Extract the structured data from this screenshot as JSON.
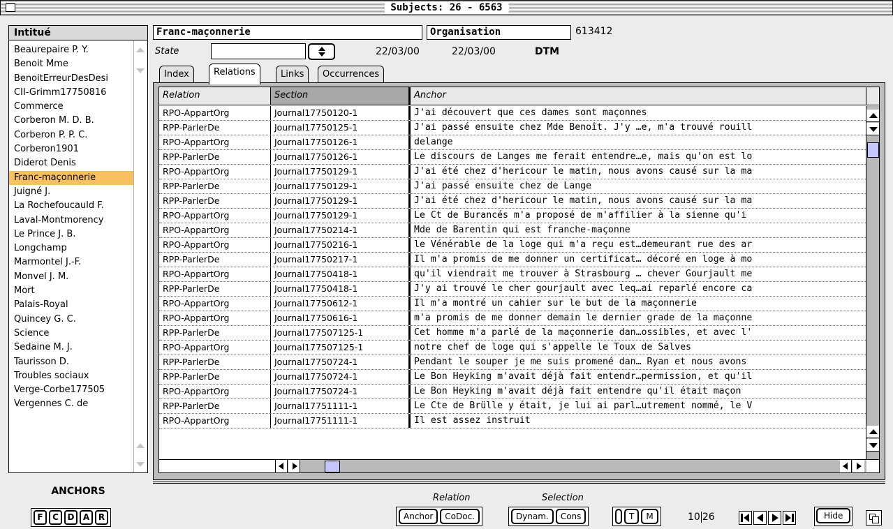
{
  "window": {
    "title": "Subjects: 26 - 6563"
  },
  "left_pane": {
    "header": "Intitué",
    "items": [
      "Beaurepaire P. Y.",
      "Benoit Mme",
      "BenoitErreurDesDesi",
      "CII-Grimm17750816",
      "Commerce",
      "Corberon M. D. B.",
      "Corberon P. P. C.",
      "Corberon1901",
      "Diderot Denis",
      "Franc-maçonnerie",
      "Juigné J.",
      "La Rochefoucauld F.",
      "Laval-Montmorency",
      "Le Prince J. B.",
      "Longchamp",
      "Marmontel  J.-F.",
      "Monvel J. M.",
      "Mort",
      "Palais-Royal",
      "Quincey G. C.",
      "Science",
      "Sedaine M. J.",
      "Taurisson D.",
      "Troubles sociaux",
      "Verge-Corbe177505",
      "Vergennes C. de"
    ],
    "selected_index": 9,
    "anchors_label": "ANCHORS",
    "anchor_buttons": [
      "F",
      "C",
      "D",
      "A",
      "R"
    ]
  },
  "record": {
    "name": "Franc-maçonnerie",
    "type": "Organisation",
    "id": "613412",
    "state_label": "State",
    "state_value": "",
    "date_created": "22/03/00",
    "date_modified": "22/03/00",
    "user": "DTM"
  },
  "tabs": [
    {
      "label": "Index",
      "active": false
    },
    {
      "label": "Relations",
      "active": true
    },
    {
      "label": "Links",
      "active": false
    },
    {
      "label": "Occurrences",
      "active": false
    }
  ],
  "table": {
    "headers": [
      "Relation",
      "Section",
      "Anchor"
    ],
    "rows": [
      [
        "RPO-AppartOrg",
        "Journal17750120-1",
        "J'ai découvert que ces dames sont maçonnes"
      ],
      [
        "RPP-ParlerDe",
        "Journal17750125-1",
        "J'ai passé ensuite chez Mde Benoît. J'y …e, m'a trouvé rouill"
      ],
      [
        "RPO-AppartOrg",
        "Journal17750126-1",
        "delange"
      ],
      [
        "RPP-ParlerDe",
        "Journal17750126-1",
        "Le discours de Langes me ferait entendre…e, mais qu'on est lo"
      ],
      [
        "RPO-AppartOrg",
        "Journal17750129-1",
        "J'ai été chez d'hericour le matin, nous avons causé sur la ma"
      ],
      [
        "RPP-ParlerDe",
        "Journal17750129-1",
        "J'ai passé ensuite chez de Lange"
      ],
      [
        "RPP-ParlerDe",
        "Journal17750129-1",
        "J'ai été chez d'hericour le matin, nous avons causé sur la ma"
      ],
      [
        "RPO-AppartOrg",
        "Journal17750129-1",
        "Le Ct  de Burancés m'a proposé de m'affilier à la sienne qu'i"
      ],
      [
        "RPO-AppartOrg",
        "Journal17750214-1",
        "Mde de Barentin qui est franche-maçonne"
      ],
      [
        "RPO-AppartOrg",
        "Journal17750216-1",
        "le Vénérable de la loge qui m'a reçu est…demeurant rue des ar"
      ],
      [
        "RPP-ParlerDe",
        "Journal17750217-1",
        "Il m'a promis de me donner un certificat… décoré en loge à mo"
      ],
      [
        "RPO-AppartOrg",
        "Journal17750418-1",
        "qu'il viendrait me trouver à Strasbourg … chever Gourjault me"
      ],
      [
        "RPP-ParlerDe",
        "Journal17750418-1",
        "J'y ai trouvé le cher gourjault avec leq…ai reparlé encore ca"
      ],
      [
        "RPO-AppartOrg",
        "Journal17750612-1",
        "Il m'a montré un cahier sur le but de la maçonnerie"
      ],
      [
        "RPO-AppartOrg",
        "Journal17750616-1",
        "m'a promis de me donner demain le dernier grade de la maçonne"
      ],
      [
        "RPP-ParlerDe",
        "Journal177507125-1",
        "Cet homme m'a parlé de la maçonnerie dan…ossibles, et avec l'"
      ],
      [
        "RPO-AppartOrg",
        "Journal177507125-1",
        "notre chef de loge qui s'appelle le Toux de Salves"
      ],
      [
        "RPP-ParlerDe",
        "Journal17750724-1",
        "Pendant le souper je me suis promené dan… Ryan et nous avons"
      ],
      [
        "RPP-ParlerDe",
        "Journal17750724-1",
        "Le Bon Heyking m'avait déjà fait entendr…permission, et qu'il"
      ],
      [
        "RPO-AppartOrg",
        "Journal17750724-1",
        "Le Bon Heyking m'avait déjà fait entendre qu'il était maçon"
      ],
      [
        "RPP-ParlerDe",
        "Journal17751111-1",
        "Le Cte de Brülle y était, je lui ai parl…utrement nommé, le V"
      ],
      [
        "RPO-AppartOrg",
        "Journal17751111-1",
        "Il est assez instruit"
      ]
    ]
  },
  "toolbar": {
    "relation_label": "Relation",
    "selection_label": "Selection",
    "relation_buttons": [
      "Anchor",
      "CoDoc."
    ],
    "selection_buttons": [
      "Dynam.",
      "Cons"
    ],
    "mode_buttons": [
      "",
      "T",
      "M"
    ],
    "page_current": "10",
    "page_total": "26",
    "hide_label": "Hide"
  },
  "colors": {
    "selection_highlight": "#f7c15f",
    "scroll_thumb": "#c7c7ff",
    "sorted_header": "#a9a9a9"
  }
}
